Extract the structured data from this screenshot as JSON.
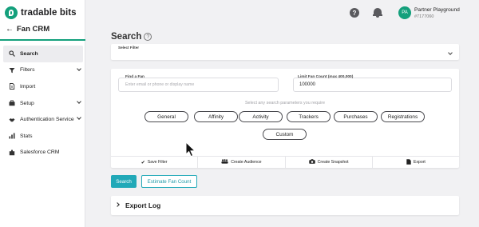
{
  "brand": {
    "name": "tradable bits"
  },
  "sidebar": {
    "back_label": "Fan CRM",
    "items": [
      {
        "label": "Search",
        "icon": "search-icon",
        "active": true
      },
      {
        "label": "Filters",
        "icon": "filter-icon",
        "expandable": true
      },
      {
        "label": "Import",
        "icon": "import-icon"
      },
      {
        "label": "Setup",
        "icon": "briefcase-icon",
        "expandable": true
      },
      {
        "label": "Authentication Service",
        "icon": "handshake-icon",
        "expandable": true
      },
      {
        "label": "Stats",
        "icon": "bar-chart-icon"
      },
      {
        "label": "Salesforce CRM",
        "icon": "puzzle-icon"
      }
    ]
  },
  "topbar": {
    "avatar_initials": "PA",
    "account_name": "Partner Playground",
    "account_id": "#7177060"
  },
  "main": {
    "title": "Search",
    "select_filter_label": "Select Filter",
    "find_fan_label": "Find a Fan",
    "find_fan_placeholder": "Enter email or phone or display name",
    "limit_label": "Limit Fan Count (max 400,000)",
    "limit_value": "100000",
    "hint": "Select any search parameters you require",
    "parameters": [
      "General",
      "Affinity",
      "Activity",
      "Trackers",
      "Purchases",
      "Registrations",
      "Custom"
    ],
    "toolbar": {
      "save_filter": "Save Filter",
      "create_audience": "Create Audience",
      "create_snapshot": "Create Snapshot",
      "export": "Export"
    },
    "search_button": "Search",
    "estimate_button": "Estimate Fan Count",
    "export_log": "Export Log"
  },
  "colors": {
    "brand_green": "#14a07c",
    "button_teal": "#22a9b8"
  }
}
